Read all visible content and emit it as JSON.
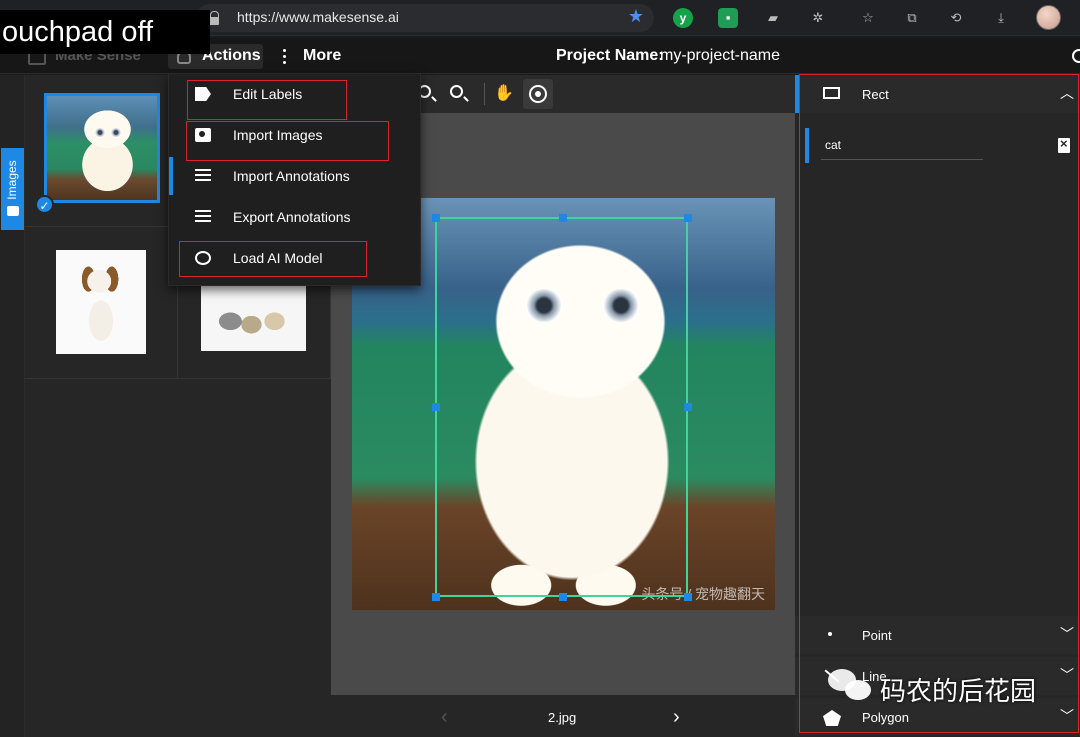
{
  "browser": {
    "url": "https://www.makesense.ai",
    "overlay_text": "ouchpad off"
  },
  "app": {
    "brand": "Make Sense",
    "menu_actions": "Actions",
    "menu_more": "More",
    "project_name_label": "Project Name:",
    "project_name_value": "my-project-name"
  },
  "sidebar": {
    "tab_label": "Images"
  },
  "actions_menu": {
    "items": [
      {
        "label": "Edit Labels",
        "icon": "tag-icon"
      },
      {
        "label": "Import Images",
        "icon": "camera-icon"
      },
      {
        "label": "Import Annotations",
        "icon": "list-add-icon"
      },
      {
        "label": "Export Annotations",
        "icon": "list-add-icon"
      },
      {
        "label": "Load AI Model",
        "icon": "ai-model-icon"
      }
    ]
  },
  "editor": {
    "current_file": "2.jpg",
    "watermark": "头条号 / 宠物趣翻天"
  },
  "right_panel": {
    "sections": [
      {
        "label": "Rect",
        "icon": "rect-icon",
        "expanded": true
      },
      {
        "label": "Point",
        "icon": "point-icon",
        "expanded": false
      },
      {
        "label": "Line",
        "icon": "line-icon",
        "expanded": false
      },
      {
        "label": "Polygon",
        "icon": "polygon-icon",
        "expanded": false
      }
    ],
    "rect_labels": [
      {
        "value": "cat"
      }
    ]
  },
  "watermark": {
    "text": "码农的后花园"
  },
  "colors": {
    "accent": "#1e88e5",
    "bbox": "#3fd59a",
    "highlight_box": "#d8232a"
  }
}
